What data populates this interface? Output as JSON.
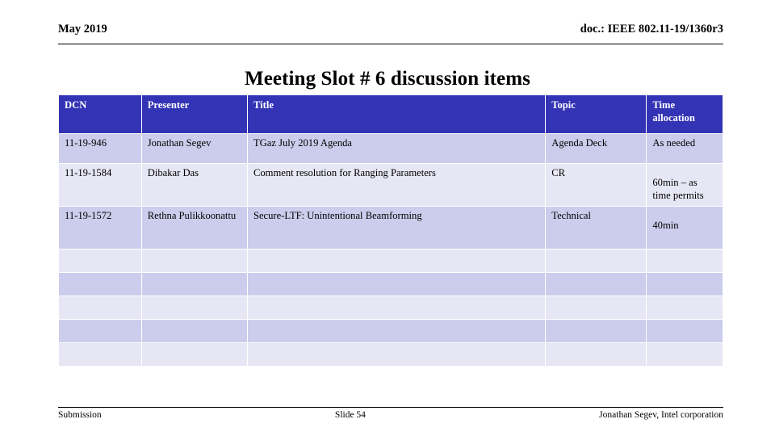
{
  "header": {
    "date": "May 2019",
    "doc_id": "doc.: IEEE 802.11-19/1360r3"
  },
  "title": "Meeting Slot # 6 discussion items",
  "table": {
    "columns": [
      {
        "key": "dcn",
        "label": "DCN"
      },
      {
        "key": "presenter",
        "label": "Presenter"
      },
      {
        "key": "title",
        "label": "Title"
      },
      {
        "key": "topic",
        "label": "Topic"
      },
      {
        "key": "time",
        "label": "Time allocation"
      }
    ],
    "rows": [
      {
        "dcn": "11-19-946",
        "presenter": "Jonathan Segev",
        "title": "TGaz July 2019 Agenda",
        "topic": "Agenda Deck",
        "time": "As needed"
      },
      {
        "dcn": "11-19-1584",
        "presenter": "Dibakar Das",
        "title": "Comment resolution for Ranging Parameters",
        "topic": "CR",
        "time": "60min – as time permits"
      },
      {
        "dcn": "11-19-1572",
        "presenter": "Rethna Pulikkoonattu",
        "title": "Secure-LTF: Unintentional Beamforming",
        "topic": "Technical",
        "time": "40min"
      }
    ],
    "empty_row_count": 5
  },
  "footer": {
    "left": "Submission",
    "center": "Slide 54",
    "right": "Jonathan Segev, Intel corporation"
  },
  "colors": {
    "header_blue": "#3333b5",
    "row_dark": "#ccccec",
    "row_light": "#e6e6f4",
    "text": "#000000",
    "header_text": "#ffffff"
  }
}
